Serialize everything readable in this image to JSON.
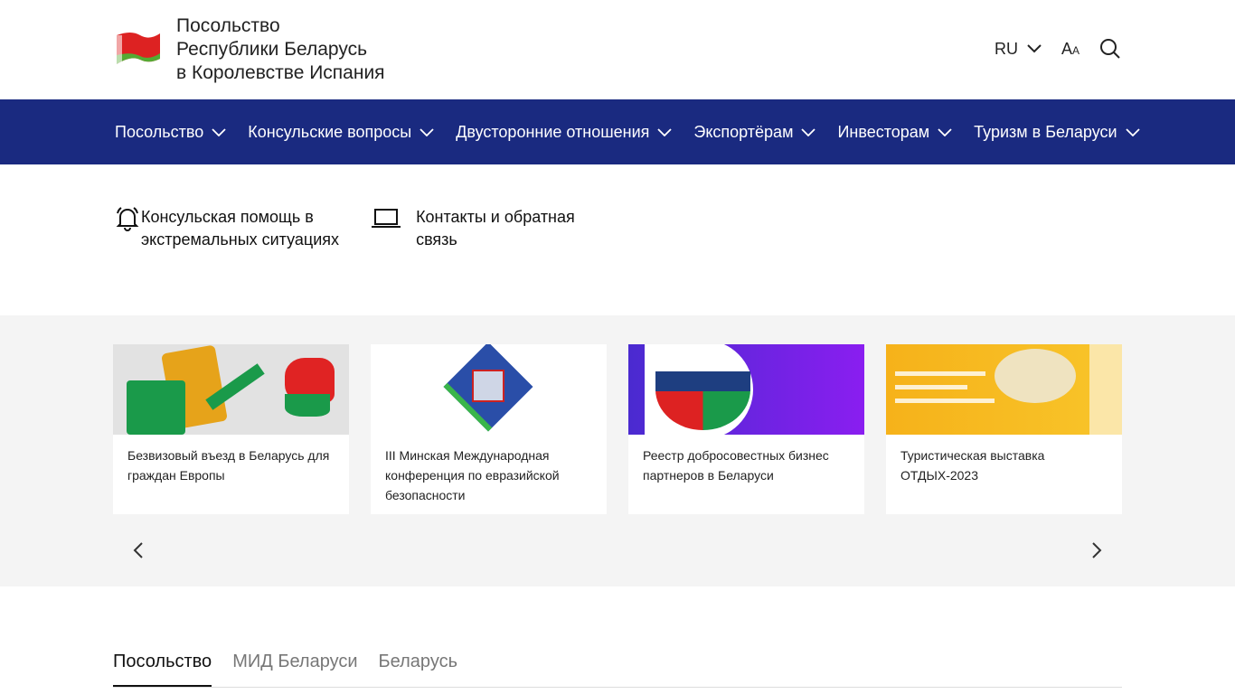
{
  "header": {
    "title_lines": [
      "Посольство",
      "Республики Беларусь",
      "в Королевстве Испания"
    ],
    "lang": "RU",
    "font_size_label_big": "A",
    "font_size_label_small": "A"
  },
  "nav": {
    "items": [
      "Посольство",
      "Консульские вопросы",
      "Двусторонние отношения",
      "Экспортёрам",
      "Инвесторам",
      "Туризм в Беларуси"
    ],
    "bg": "#1a2a80"
  },
  "quick_links": [
    {
      "icon": "bell-icon",
      "label": "Консульская помощь в экстремальных ситуациях"
    },
    {
      "icon": "laptop-icon",
      "label": "Контакты и обратная связь"
    }
  ],
  "cards": [
    {
      "title": "Безвизовый въезд в Беларусь для граждан Европы"
    },
    {
      "title": "III Минская Международная конференция по евразийской безопасности"
    },
    {
      "title": "Реестр добросовестных бизнес партнеров в Беларуси"
    },
    {
      "title": "Туристическая выставка ОТДЫХ-2023"
    }
  ],
  "tabs": [
    {
      "label": "Посольство",
      "active": true
    },
    {
      "label": "МИД Беларуси"
    },
    {
      "label": "Беларусь"
    }
  ]
}
